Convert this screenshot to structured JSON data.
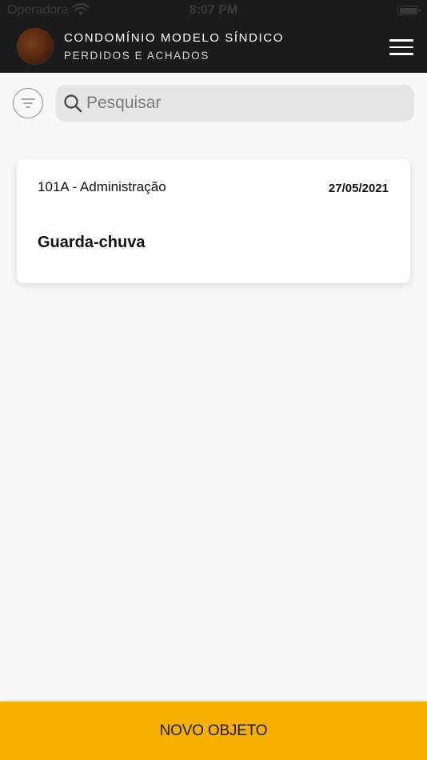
{
  "status_bar": {
    "carrier": "Operadora",
    "time": "8:07 PM",
    "icons": [
      "wifi-icon",
      "battery-icon"
    ]
  },
  "header": {
    "title": "CONDOMÍNIO MODELO SÍNDICO",
    "subtitle": "PERDIDOS E ACHADOS",
    "menu_icon": "hamburger-menu-icon"
  },
  "search": {
    "filter_icon": "filter-icon",
    "search_icon": "search-icon",
    "placeholder": "Pesquisar",
    "value": ""
  },
  "items": [
    {
      "unit": "101A - Administração",
      "date": "27/05/2021",
      "object": "Guarda-chuva"
    }
  ],
  "actions": {
    "new_object_label": "NOVO OBJETO"
  },
  "colors": {
    "header_background": "#1b1b1b",
    "accent": "#f5b000",
    "page_background": "#f8f8f8",
    "card_background": "#ffffff"
  }
}
